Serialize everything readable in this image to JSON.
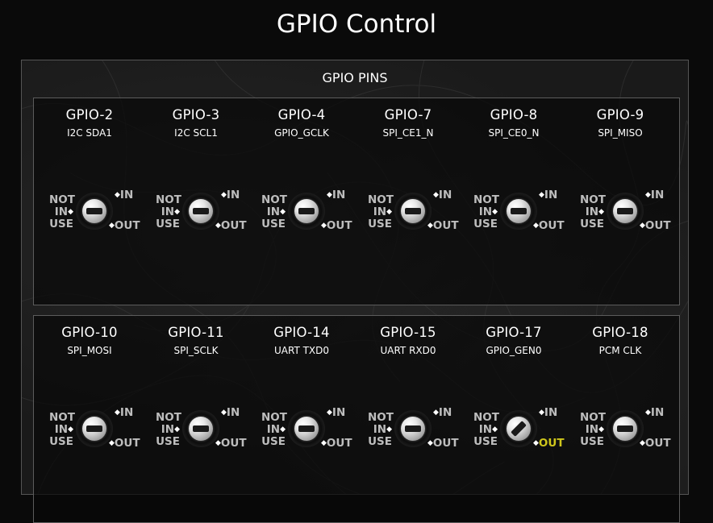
{
  "page": {
    "title": "GPIO Control"
  },
  "panel": {
    "title": "GPIO PINS"
  },
  "switch_labels": {
    "not": "NOT",
    "in_mid": "IN",
    "use": "USE",
    "in": "IN",
    "out": "OUT"
  },
  "colors": {
    "active_label": "#cfc61c",
    "inactive_label": "#bdbdbd"
  },
  "groups": [
    {
      "pins": [
        {
          "name": "GPIO-2",
          "function": "I2C SDA1",
          "state": "not_in_use"
        },
        {
          "name": "GPIO-3",
          "function": "I2C SCL1",
          "state": "not_in_use"
        },
        {
          "name": "GPIO-4",
          "function": "GPIO_GCLK",
          "state": "not_in_use"
        },
        {
          "name": "GPIO-7",
          "function": "SPI_CE1_N",
          "state": "not_in_use"
        },
        {
          "name": "GPIO-8",
          "function": "SPI_CE0_N",
          "state": "not_in_use"
        },
        {
          "name": "GPIO-9",
          "function": "SPI_MISO",
          "state": "not_in_use"
        }
      ]
    },
    {
      "pins": [
        {
          "name": "GPIO-10",
          "function": "SPI_MOSI",
          "state": "not_in_use"
        },
        {
          "name": "GPIO-11",
          "function": "SPI_SCLK",
          "state": "not_in_use"
        },
        {
          "name": "GPIO-14",
          "function": "UART TXD0",
          "state": "not_in_use"
        },
        {
          "name": "GPIO-15",
          "function": "UART RXD0",
          "state": "not_in_use"
        },
        {
          "name": "GPIO-17",
          "function": "GPIO_GEN0",
          "state": "out"
        },
        {
          "name": "GPIO-18",
          "function": "PCM CLK",
          "state": "not_in_use"
        }
      ]
    }
  ]
}
